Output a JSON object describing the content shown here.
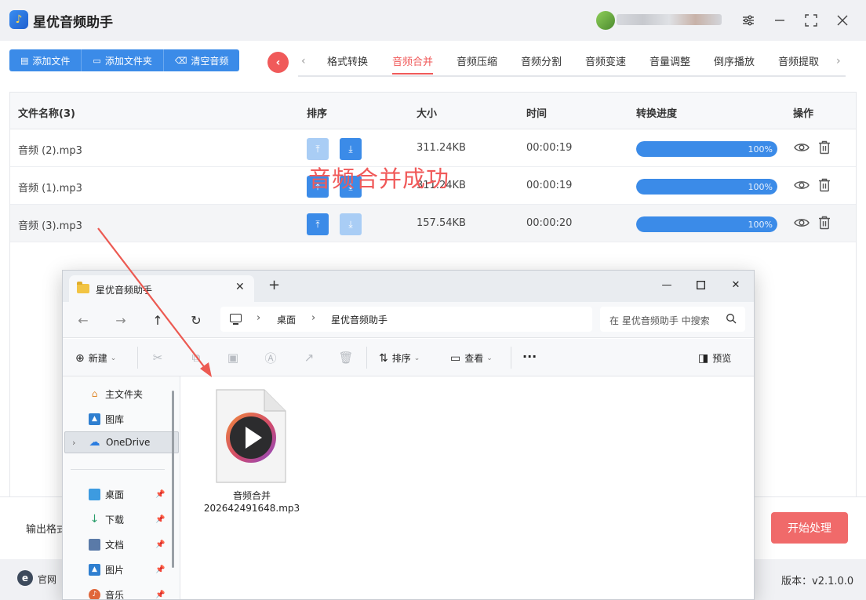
{
  "app": {
    "title": "星优音频助手",
    "logo_icon": "music-note-icon"
  },
  "toolbar": {
    "add_file": "添加文件",
    "add_folder": "添加文件夹",
    "clear_audio": "清空音频"
  },
  "tabs": [
    {
      "label": "格式转换"
    },
    {
      "label": "音频合并",
      "active": true
    },
    {
      "label": "音频压缩"
    },
    {
      "label": "音频分割"
    },
    {
      "label": "音频变速"
    },
    {
      "label": "音量调整"
    },
    {
      "label": "倒序播放"
    },
    {
      "label": "音频提取"
    }
  ],
  "table": {
    "headers": {
      "name": "文件名称(3)",
      "order": "排序",
      "size": "大小",
      "time": "时间",
      "progress": "转换进度",
      "actions": "操作"
    },
    "rows": [
      {
        "name": "音频 (2).mp3",
        "size": "311.24KB",
        "time": "00:00:19",
        "progress": 1.0,
        "progress_text": "100%",
        "up_enabled": false,
        "down_enabled": true
      },
      {
        "name": "音频 (1).mp3",
        "size": "311.24KB",
        "time": "00:00:19",
        "progress": 1.0,
        "progress_text": "100%",
        "up_enabled": true,
        "down_enabled": true
      },
      {
        "name": "音频 (3).mp3",
        "size": "157.54KB",
        "time": "00:00:20",
        "progress": 1.0,
        "progress_text": "100%",
        "up_enabled": true,
        "down_enabled": false
      }
    ]
  },
  "bottom": {
    "output_format_label": "输出格式",
    "start_button": "开始处理",
    "website_label": "官网",
    "version": "版本：v2.1.0.0"
  },
  "explorer": {
    "tab_title": "星优音频助手",
    "breadcrumb": [
      "桌面",
      "星优音频助手"
    ],
    "search_placeholder": "在 星优音频助手 中搜索",
    "commands": {
      "new": "新建",
      "sort": "排序",
      "view": "查看",
      "more": "···",
      "preview": "预览"
    },
    "sidebar": {
      "home": "主文件夹",
      "gallery": "图库",
      "onedrive": "OneDrive",
      "desktop": "桌面",
      "downloads": "下载",
      "documents": "文档",
      "pictures": "图片",
      "music": "音乐"
    },
    "file": {
      "name_line1": "音频合并",
      "name_line2": "202642491648.mp3"
    }
  },
  "annotation": {
    "success_text": "音频合并成功"
  },
  "colors": {
    "primary_blue": "#3b8be8",
    "accent_red": "#f05a5a",
    "start_button": "#f06a6a"
  }
}
